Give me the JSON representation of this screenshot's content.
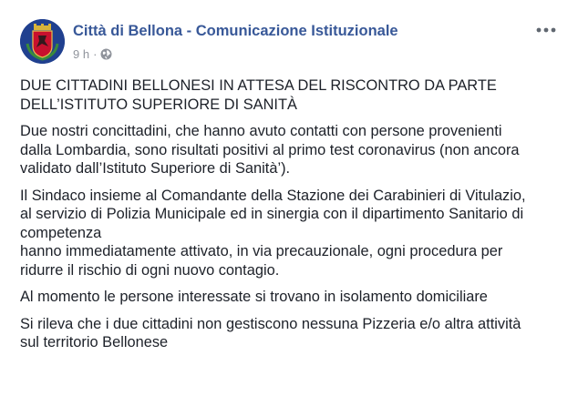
{
  "post": {
    "page_name": "Città di Bellona - Comunicazione Istituzionale",
    "time": "9 h",
    "separator": "·",
    "icons": {
      "avatar": "town-coat-of-arms",
      "privacy": "globe-icon",
      "menu": "more-options-icon"
    },
    "paragraphs": [
      [
        "DUE CITTADINI BELLONESI IN ATTESA DEL RISCONTRO DA PARTE",
        "DELL’ISTITUTO SUPERIORE DI SANITÀ"
      ],
      [
        "Due nostri concittadini, che hanno avuto contatti con persone provenienti",
        "dalla Lombardia, sono risultati positivi al primo test coronavirus (non ancora",
        "validato dall’Istituto Superiore di Sanità’)."
      ],
      [
        "Il Sindaco insieme al Comandante della Stazione dei Carabinieri di Vitulazio,",
        "al servizio di Polizia Municipale ed in sinergia con il dipartimento Sanitario di",
        "competenza",
        "hanno immediatamente attivato, in via precauzionale, ogni procedura per",
        "ridurre il rischio di ogni nuovo contagio."
      ],
      [
        "Al momento le persone interessate si trovano in isolamento domiciliare"
      ],
      [
        "Si rileva che i due cittadini non gestiscono nessuna Pizzeria e/o altra attività",
        "sul territorio Bellonese"
      ]
    ]
  },
  "colors": {
    "link": "#385898",
    "text": "#1d2129",
    "meta": "#90949c",
    "avatar_bg": "#1f3f8f",
    "crest_red": "#c8102e"
  }
}
